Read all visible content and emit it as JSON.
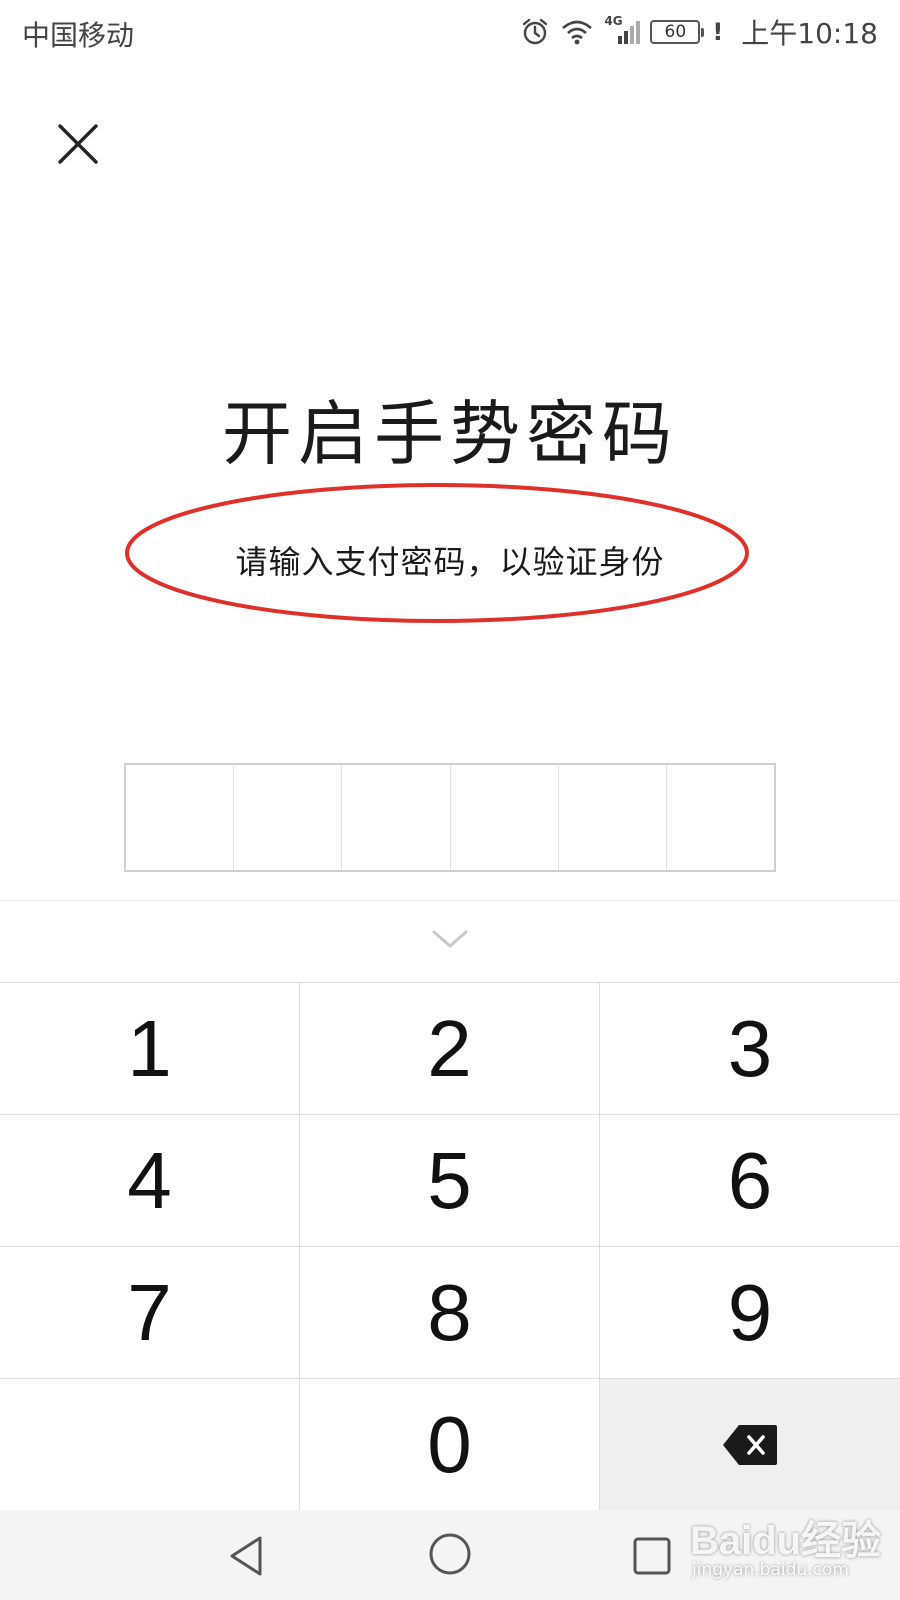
{
  "status_bar": {
    "carrier": "中国移动",
    "network": "4G",
    "battery": "60",
    "alert": "!",
    "time": "上午10:18",
    "icons": [
      "alarm-icon",
      "wifi-icon",
      "signal-icon",
      "battery-icon"
    ]
  },
  "header": {
    "close_icon": "close-icon"
  },
  "main": {
    "title": "开启手势密码",
    "subtitle": "请输入支付密码，以验证身份",
    "annotation_color": "#e0302a",
    "pin_length": 6
  },
  "keypad": {
    "keys": [
      "1",
      "2",
      "3",
      "4",
      "5",
      "6",
      "7",
      "8",
      "9",
      "",
      "0",
      ""
    ],
    "collapse_icon": "chevron-down-icon",
    "delete_icon": "backspace-icon"
  },
  "nav_bar": {
    "icons": [
      "back-triangle-icon",
      "home-circle-icon",
      "recent-square-icon"
    ]
  },
  "watermark": {
    "logo": "Baidu经验",
    "url": "jingyan.baidu.com"
  }
}
